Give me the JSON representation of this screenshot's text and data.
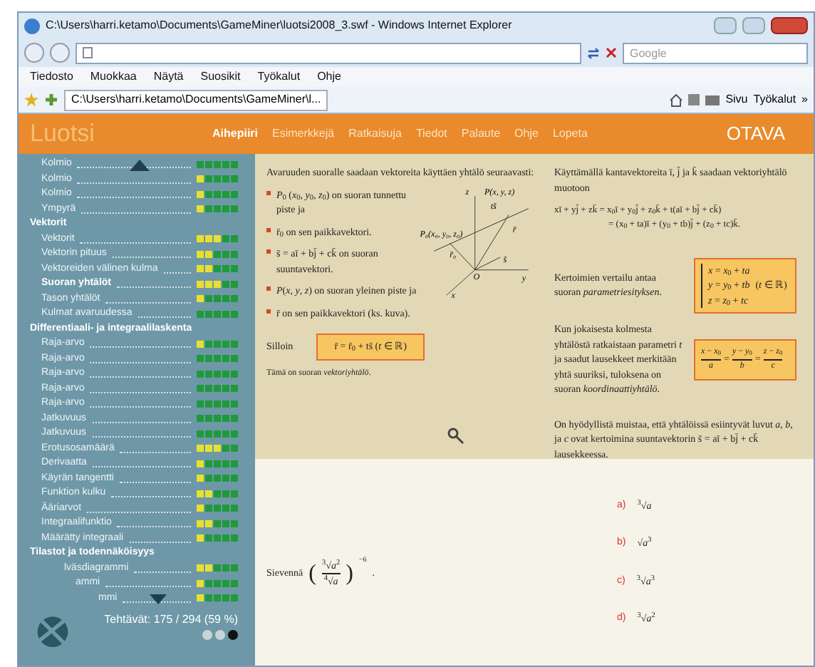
{
  "window": {
    "title": "C:\\Users\\harri.ketamo\\Documents\\GameMiner\\luotsi2008_3.swf - Windows Internet Explorer"
  },
  "search": {
    "placeholder": "Google"
  },
  "menu": [
    "Tiedosto",
    "Muokkaa",
    "Näytä",
    "Suosikit",
    "Työkalut",
    "Ohje"
  ],
  "tab": {
    "title": "C:\\Users\\harri.ketamo\\Documents\\GameMiner\\l..."
  },
  "toolbar": [
    "Sivu",
    "Työkalut",
    "»"
  ],
  "app": {
    "logo": "Luotsi",
    "publisher": "OTAVA",
    "nav": [
      {
        "label": "Aihepiiri",
        "selected": true
      },
      {
        "label": "Esimerkkejä",
        "selected": false
      },
      {
        "label": "Ratkaisuja",
        "selected": false
      },
      {
        "label": "Tiedot",
        "selected": false
      },
      {
        "label": "Palaute",
        "selected": false
      },
      {
        "label": "Ohje",
        "selected": false
      },
      {
        "label": "Lopeta",
        "selected": false
      }
    ],
    "sidebar": [
      {
        "kind": "item",
        "label": "Kolmio",
        "selected": false,
        "squares": [
          {
            "color": "#1f9a3a"
          },
          {
            "color": "#1f9a3a"
          },
          {
            "color": "#1f9a3a"
          },
          {
            "color": "#1f9a3a"
          },
          {
            "color": "#1f9a3a"
          }
        ]
      },
      {
        "kind": "item",
        "label": "Kolmio",
        "selected": false,
        "squares": [
          {
            "color": "#e8e030"
          },
          {
            "color": "#1f9a3a"
          },
          {
            "color": "#1f9a3a"
          },
          {
            "color": "#1f9a3a"
          },
          {
            "color": "#1f9a3a"
          }
        ]
      },
      {
        "kind": "item",
        "label": "Kolmio",
        "selected": false,
        "squares": [
          {
            "color": "#e8e030"
          },
          {
            "color": "#1f9a3a"
          },
          {
            "color": "#1f9a3a"
          },
          {
            "color": "#1f9a3a"
          },
          {
            "color": "#1f9a3a"
          }
        ]
      },
      {
        "kind": "item",
        "label": "Ympyrä",
        "selected": false,
        "squares": [
          {
            "color": "#e8e030"
          },
          {
            "color": "#1f9a3a"
          },
          {
            "color": "#1f9a3a"
          },
          {
            "color": "#1f9a3a"
          },
          {
            "color": "#1f9a3a"
          }
        ]
      },
      {
        "kind": "header",
        "label": "Vektorit"
      },
      {
        "kind": "item",
        "label": "Vektorit",
        "selected": false,
        "squares": [
          {
            "color": "#e8e030"
          },
          {
            "color": "#e8e030"
          },
          {
            "color": "#e8e030"
          },
          {
            "color": "#1f9a3a"
          },
          {
            "color": "#1f9a3a"
          }
        ]
      },
      {
        "kind": "item",
        "label": "Vektorin pituus",
        "selected": false,
        "squares": [
          {
            "color": "#e8e030"
          },
          {
            "color": "#e8e030"
          },
          {
            "color": "#1f9a3a"
          },
          {
            "color": "#1f9a3a"
          },
          {
            "color": "#1f9a3a"
          }
        ]
      },
      {
        "kind": "item",
        "label": "Vektoreiden välinen kulma",
        "selected": false,
        "squares": [
          {
            "color": "#e8e030"
          },
          {
            "color": "#e8e030"
          },
          {
            "color": "#1f9a3a"
          },
          {
            "color": "#1f9a3a"
          },
          {
            "color": "#1f9a3a"
          }
        ]
      },
      {
        "kind": "item",
        "label": "Suoran yhtälöt",
        "selected": true,
        "squares": [
          {
            "color": "#e8e030"
          },
          {
            "color": "#e8e030"
          },
          {
            "color": "#e8e030"
          },
          {
            "color": "#1f9a3a"
          },
          {
            "color": "#1f9a3a"
          }
        ]
      },
      {
        "kind": "item",
        "label": "Tason yhtälöt",
        "selected": false,
        "squares": [
          {
            "color": "#e8e030"
          },
          {
            "color": "#1f9a3a"
          },
          {
            "color": "#1f9a3a"
          },
          {
            "color": "#1f9a3a"
          },
          {
            "color": "#1f9a3a"
          }
        ]
      },
      {
        "kind": "item",
        "label": "Kulmat avaruudessa",
        "selected": false,
        "squares": [
          {
            "color": "#1f9a3a"
          },
          {
            "color": "#1f9a3a"
          },
          {
            "color": "#1f9a3a"
          },
          {
            "color": "#1f9a3a"
          },
          {
            "color": "#1f9a3a"
          }
        ]
      },
      {
        "kind": "header",
        "label": "Differentiaali- ja integraalilaskenta"
      },
      {
        "kind": "item",
        "label": "Raja-arvo",
        "selected": false,
        "squares": [
          {
            "color": "#e8e030"
          },
          {
            "color": "#1f9a3a"
          },
          {
            "color": "#1f9a3a"
          },
          {
            "color": "#1f9a3a"
          },
          {
            "color": "#1f9a3a"
          }
        ]
      },
      {
        "kind": "item",
        "label": "Raja-arvo",
        "selected": false,
        "squares": [
          {
            "color": "#1f9a3a"
          },
          {
            "color": "#1f9a3a"
          },
          {
            "color": "#1f9a3a"
          },
          {
            "color": "#1f9a3a"
          },
          {
            "color": "#1f9a3a"
          }
        ]
      },
      {
        "kind": "item",
        "label": "Raja-arvo",
        "selected": false,
        "squares": [
          {
            "color": "#1f9a3a"
          },
          {
            "color": "#1f9a3a"
          },
          {
            "color": "#1f9a3a"
          },
          {
            "color": "#1f9a3a"
          },
          {
            "color": "#1f9a3a"
          }
        ]
      },
      {
        "kind": "item",
        "label": "Raja-arvo",
        "selected": false,
        "squares": [
          {
            "color": "#1f9a3a"
          },
          {
            "color": "#1f9a3a"
          },
          {
            "color": "#1f9a3a"
          },
          {
            "color": "#1f9a3a"
          },
          {
            "color": "#1f9a3a"
          }
        ]
      },
      {
        "kind": "item",
        "label": "Raja-arvo",
        "selected": false,
        "squares": [
          {
            "color": "#1f9a3a"
          },
          {
            "color": "#1f9a3a"
          },
          {
            "color": "#1f9a3a"
          },
          {
            "color": "#1f9a3a"
          },
          {
            "color": "#1f9a3a"
          }
        ]
      },
      {
        "kind": "item",
        "label": "Jatkuvuus",
        "selected": false,
        "squares": [
          {
            "color": "#1f9a3a"
          },
          {
            "color": "#1f9a3a"
          },
          {
            "color": "#1f9a3a"
          },
          {
            "color": "#1f9a3a"
          },
          {
            "color": "#1f9a3a"
          }
        ]
      },
      {
        "kind": "item",
        "label": "Jatkuvuus",
        "selected": false,
        "squares": [
          {
            "color": "#1f9a3a"
          },
          {
            "color": "#1f9a3a"
          },
          {
            "color": "#1f9a3a"
          },
          {
            "color": "#1f9a3a"
          },
          {
            "color": "#1f9a3a"
          }
        ]
      },
      {
        "kind": "item",
        "label": "Erotusosamäärä",
        "selected": false,
        "squares": [
          {
            "color": "#e8e030"
          },
          {
            "color": "#e8e030"
          },
          {
            "color": "#e8e030"
          },
          {
            "color": "#1f9a3a"
          },
          {
            "color": "#1f9a3a"
          }
        ]
      },
      {
        "kind": "item",
        "label": "Derivaatta",
        "selected": false,
        "squares": [
          {
            "color": "#e8e030"
          },
          {
            "color": "#1f9a3a"
          },
          {
            "color": "#1f9a3a"
          },
          {
            "color": "#1f9a3a"
          },
          {
            "color": "#1f9a3a"
          }
        ]
      },
      {
        "kind": "item",
        "label": "Käyrän tangentti",
        "selected": false,
        "squares": [
          {
            "color": "#e8e030"
          },
          {
            "color": "#1f9a3a"
          },
          {
            "color": "#1f9a3a"
          },
          {
            "color": "#1f9a3a"
          },
          {
            "color": "#1f9a3a"
          }
        ]
      },
      {
        "kind": "item",
        "label": "Funktion kulku",
        "selected": false,
        "squares": [
          {
            "color": "#e8e030"
          },
          {
            "color": "#e8e030"
          },
          {
            "color": "#1f9a3a"
          },
          {
            "color": "#1f9a3a"
          },
          {
            "color": "#1f9a3a"
          }
        ]
      },
      {
        "kind": "item",
        "label": "Ääriarvot",
        "selected": false,
        "squares": [
          {
            "color": "#e8e030"
          },
          {
            "color": "#1f9a3a"
          },
          {
            "color": "#1f9a3a"
          },
          {
            "color": "#1f9a3a"
          },
          {
            "color": "#1f9a3a"
          }
        ]
      },
      {
        "kind": "item",
        "label": "Integraalifunktio",
        "selected": false,
        "squares": [
          {
            "color": "#e8e030"
          },
          {
            "color": "#e8e030"
          },
          {
            "color": "#1f9a3a"
          },
          {
            "color": "#1f9a3a"
          },
          {
            "color": "#1f9a3a"
          }
        ]
      },
      {
        "kind": "item",
        "label": "Määrätty integraali",
        "selected": false,
        "squares": [
          {
            "color": "#e8e030"
          },
          {
            "color": "#1f9a3a"
          },
          {
            "color": "#1f9a3a"
          },
          {
            "color": "#1f9a3a"
          },
          {
            "color": "#1f9a3a"
          }
        ]
      },
      {
        "kind": "header",
        "label": "Tilastot ja todennäköisyys"
      },
      {
        "kind": "item",
        "label": "lväsdiagrammi",
        "selected": false,
        "squares": [
          {
            "color": "#e8e030"
          },
          {
            "color": "#e8e030"
          },
          {
            "color": "#1f9a3a"
          },
          {
            "color": "#1f9a3a"
          },
          {
            "color": "#1f9a3a"
          }
        ]
      },
      {
        "kind": "item",
        "label": "ammi",
        "selected": false,
        "squares": [
          {
            "color": "#e8e030"
          },
          {
            "color": "#1f9a3a"
          },
          {
            "color": "#1f9a3a"
          },
          {
            "color": "#1f9a3a"
          },
          {
            "color": "#1f9a3a"
          }
        ]
      },
      {
        "kind": "item",
        "label": "mmi",
        "selected": false,
        "squares": [
          {
            "color": "#e8e030"
          },
          {
            "color": "#1f9a3a"
          },
          {
            "color": "#1f9a3a"
          },
          {
            "color": "#1f9a3a"
          },
          {
            "color": "#1f9a3a"
          }
        ]
      }
    ],
    "progress": "Tehtävät: 175 / 294 (59 %)",
    "theory": {
      "intro": "Avaruuden suoralle saadaan vektoreita käyttäen yhtälö seuraavasti:",
      "bullets": [
        "*P*$_{0}$ (*x*$_{0}$, *y*$_{0}$, *z*$_{0}$) on suoran tunnettu piste ja",
        "r̄$_{0}$ on sen paikkavektori.",
        "s̄ = aī + bj̄ + ck̄ on suoran suuntavektori.",
        "*P*(*x*, *y*, *z*) on suoran yleinen piste ja",
        "r̄ on sen paikkavektori (ks. kuva)."
      ],
      "then_label": "Silloin",
      "vector_equation": "r̄ = r̄$_{0}$ + ts̄   (*t* ∈ ℝ)",
      "note": "Tämä on suoran *vektoriyhtälö*.",
      "figure_labels": [
        "z",
        "P(x, y, z)",
        "P₀(x₀, y₀, z₀)",
        "r̄₀",
        "ts̄",
        "r̄",
        "s̄",
        "O",
        "y",
        "x"
      ],
      "basis_text": "Käyttämällä kantavektoreita ī, j̄ ja k̄ saadaan vektoriyhtälö muotoon",
      "equations": [
        "xī + yj̄ + zk̄ = x$_{0}$ī + y$_{0}$j̄ + z$_{0}$k̄ + t(aī + bj̄ + ck̄)",
        "= (x$_{0}$ + ta)ī + (y$_{0}$ + tb)j̄ + (z$_{0}$ + tc)k̄."
      ],
      "param_text": "Kertoimien vertailu antaa suoran *parametriesityksen*.",
      "param_system": [
        "*x* = *x*$_{0}$ + *ta*",
        "*y* = *y*$_{0}$ + *tb*",
        "*z* = *z*$_{0}$ + *tc*"
      ],
      "param_domain": "(*t* ∈ ℝ)",
      "coord_text": "Kun jokaisesta kolmesta yhtälöstä ratkaistaan parametri *t* ja saadut lausekkeet merkitään yhtä suuriksi, tuloksena on suoran *koordinaattiyhtälö*.",
      "fractions": [
        {
          "num": "*x* − *x*$_{0}$",
          "den": "*a*"
        },
        {
          "num": "*y* − *y*$_{0}$",
          "den": "*b*"
        },
        {
          "num": "*z* − *z*$_{0}$",
          "den": "*c*"
        }
      ],
      "fraction_sep": "=",
      "reminder": "On hyödyllistä muistaa, että yhtälöissä esiintyvät luvut *a*, *b*, ja *c* ovat kertoimina suuntavektorin s̄ = aī + bj̄ + ck̄ lausekkeessa."
    },
    "exercise": {
      "prompt": "Sievennä",
      "open_paren": "(",
      "numerator": "$^{3}$√*a*$^{2}$",
      "denominator": "$^{4}$√*a*",
      "close_paren": ")",
      "exponent": "−6",
      "end": ".",
      "options": [
        {
          "letter": "a)",
          "answer": "$^{3}$√*a*"
        },
        {
          "letter": "b)",
          "answer": "√*a*$^{3}$"
        },
        {
          "letter": "c)",
          "answer": "$^{3}$√*a*$^{3}$"
        },
        {
          "letter": "d)",
          "answer": "$^{3}$√*a*$^{2}$"
        }
      ]
    }
  }
}
